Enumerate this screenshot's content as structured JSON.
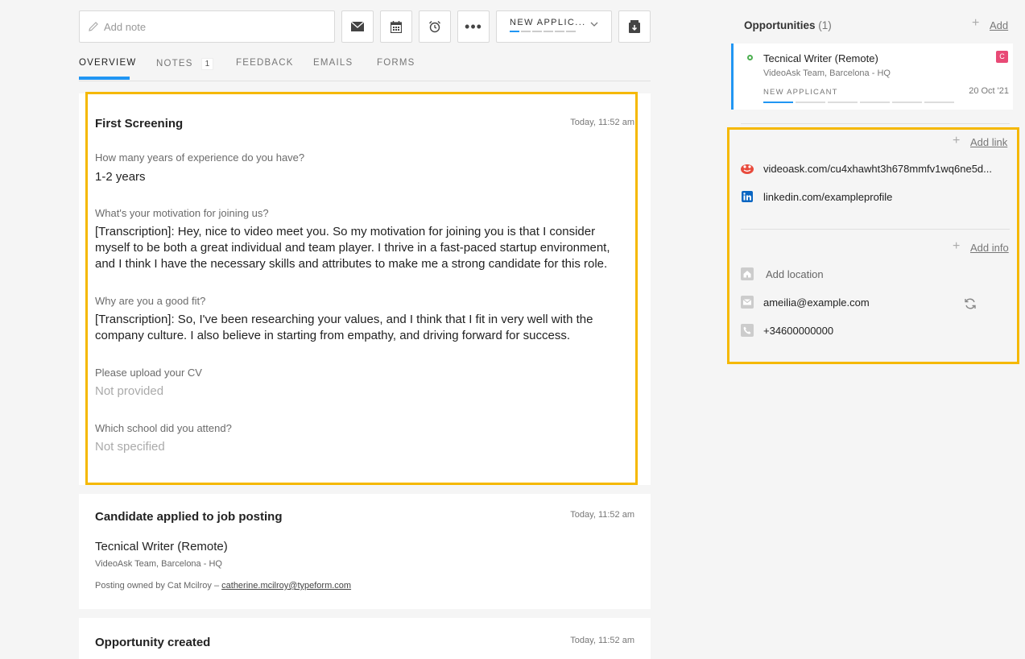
{
  "toolbar": {
    "note_placeholder": "Add note",
    "stage_label": "NEW APPLIC..."
  },
  "tabs": [
    {
      "label": "OVERVIEW"
    },
    {
      "label": "NOTES",
      "badge": "1"
    },
    {
      "label": "FEEDBACK"
    },
    {
      "label": "EMAILS"
    },
    {
      "label": "FORMS"
    }
  ],
  "screening": {
    "title": "First Screening",
    "time": "Today, 11:52 am",
    "items": [
      {
        "question": "How many years of experience do you have?",
        "answer": "1-2 years"
      },
      {
        "question": "What's your motivation for joining us?",
        "answer": "[Transcription]: Hey, nice to video meet you. So my motivation for joining you is that I consider myself to be both a great individual and team player. I thrive in a fast-paced startup environment, and I think I have the necessary skills and attributes to make me a strong candidate for this role."
      },
      {
        "question": "Why are you a good fit?",
        "answer": "[Transcription]: So, I've been researching your values, and I think that I fit in very well with the company culture. I also believe in starting from empathy, and driving forward for success."
      },
      {
        "question": "Please upload your CV",
        "answer": "Not provided"
      },
      {
        "question": "Which school did you attend?",
        "answer": "Not specified"
      }
    ]
  },
  "applied": {
    "title": "Candidate applied to job posting",
    "time": "Today, 11:52 am",
    "job": "Tecnical Writer (Remote)",
    "team": "VideoAsk Team, Barcelona - HQ",
    "owner_prefix": "Posting owned by Cat Mcilroy –",
    "owner_email": "catherine.mcilroy@typeform.com"
  },
  "created": {
    "title": "Opportunity created",
    "time": "Today, 11:52 am"
  },
  "opportunities": {
    "title": "Opportunities",
    "count": "(1)",
    "add_label": "Add",
    "item": {
      "name": "Tecnical Writer (Remote)",
      "team": "VideoAsk Team, Barcelona - HQ",
      "stage": "NEW APPLICANT",
      "date": "20 Oct '21",
      "tag": "C"
    }
  },
  "links": {
    "add_label": "Add link",
    "items": [
      {
        "icon": "videoask-icon",
        "text": "videoask.com/cu4xhawht3h678mmfv1wq6ne5d..."
      },
      {
        "icon": "linkedin-icon",
        "text": "linkedin.com/exampleprofile"
      }
    ]
  },
  "info": {
    "add_label": "Add info",
    "location": "Add location",
    "email": "ameilia@example.com",
    "phone": "+34600000000"
  },
  "colors": {
    "accent": "#2196f3",
    "highlight": "#f5b800"
  }
}
